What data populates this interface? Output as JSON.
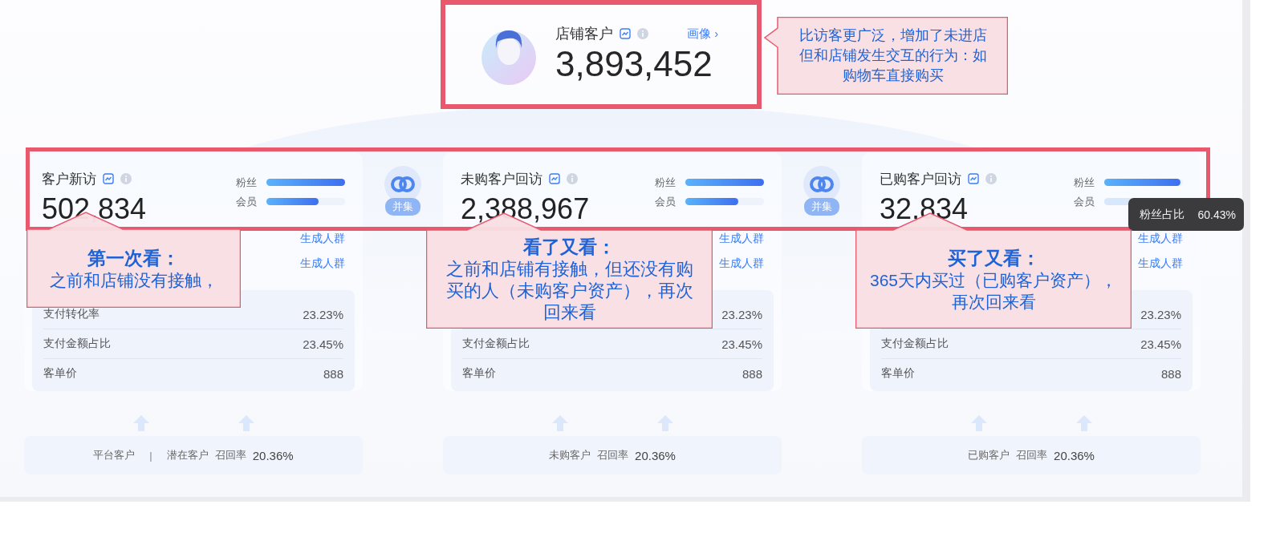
{
  "store_customers": {
    "title": "店铺客户",
    "link": "画像",
    "link_arrow": "›",
    "value": "3,893,452"
  },
  "top_note": "比访客更广泛，增加了未进店但和店铺发生交互的行为：如购物车直接购买",
  "segments": [
    {
      "title": "客户新访",
      "value": "502,834",
      "bars": [
        {
          "label": "粉丝",
          "level": 1,
          "dimmed": false
        },
        {
          "label": "会员",
          "level": 0.66,
          "dimmed": false
        }
      ],
      "actions": [
        "生成人群",
        "生成人群"
      ],
      "metrics": [
        {
          "label": "支付转化率",
          "value": "23.23%"
        },
        {
          "label": "支付金额占比",
          "value": "23.45%"
        },
        {
          "label": "客单价",
          "value": "888"
        }
      ],
      "sources": [
        "平台客户",
        "潜在客户"
      ],
      "separator": "|",
      "recall_label": "召回率",
      "recall": "20.36%",
      "note": {
        "title": "第一次看：",
        "text": "之前和店铺没有接触，"
      }
    },
    {
      "title": "未购客户回访",
      "value": "2,388,967",
      "bars": [
        {
          "label": "粉丝",
          "level": 1,
          "dimmed": false
        },
        {
          "label": "会员",
          "level": 0.67,
          "dimmed": false
        }
      ],
      "actions": [
        "生成人群",
        "生成人群"
      ],
      "metrics": [
        {
          "value": "23.23%"
        },
        {
          "label": "支付金额占比",
          "value": "23.45%"
        },
        {
          "label": "客单价",
          "value": "888"
        }
      ],
      "sources": [
        "未购客户"
      ],
      "recall_label": "召回率",
      "recall": "20.36%",
      "note": {
        "title": "看了又看：",
        "text": "之前和店铺有接触，但还没有购买的人（未购客户资产），再次回来看"
      }
    },
    {
      "title": "已购客户回访",
      "value": "32,834",
      "bars": [
        {
          "label": "粉丝",
          "level": 0.97,
          "dimmed": false
        },
        {
          "label": "会员",
          "level": 0.4,
          "dimmed": true
        }
      ],
      "actions": [
        "生成人群",
        "生成人群"
      ],
      "metrics": [
        {
          "value": "23.23%"
        },
        {
          "label": "支付金额占比",
          "value": "23.45%"
        },
        {
          "label": "客单价",
          "value": "888"
        }
      ],
      "sources": [
        "已购客户"
      ],
      "recall_label": "召回率",
      "recall": "20.36%",
      "note": {
        "title": "买了又看：",
        "text": "365天内买过（已购客户资产），再次回来看"
      }
    }
  ],
  "union_labels": [
    "并集",
    "并集"
  ],
  "tooltip": {
    "label": "粉丝占比",
    "value": "60.43%"
  }
}
